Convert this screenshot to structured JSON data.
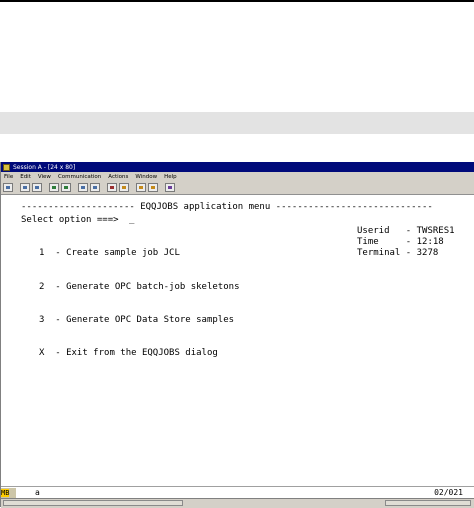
{
  "window": {
    "title": "Session A - [24 x 80]"
  },
  "menubar": {
    "items": [
      "File",
      "Edit",
      "View",
      "Communication",
      "Actions",
      "Window",
      "Help"
    ]
  },
  "toolbar": {
    "icons": [
      "print-icon",
      "copy-icon",
      "paste-icon",
      "send-icon",
      "receive-icon",
      "display-icon",
      "keypad-icon",
      "color-icon",
      "map-icon",
      "record-icon",
      "play-icon",
      "help-icon"
    ]
  },
  "screen": {
    "header": "--------------------- EQQJOBS application menu -----------------------------",
    "prompt": "Select option ===>",
    "cursor": "_",
    "info_labels": {
      "userid": "Userid   - TWSRES1",
      "time": "Time     - 12:18",
      "terminal": "Terminal - 3278"
    },
    "options": [
      "1  - Create sample job JCL",
      "2  - Generate OPC batch-job skeletons",
      "3  - Generate OPC Data Store samples",
      "X  - Exit from the EQQJOBS dialog"
    ]
  },
  "oia": {
    "indicator": "MB",
    "input_mode": "a",
    "cursor_position": "02/021"
  },
  "colors": {
    "titlebar": "#000a7a",
    "chrome": "#d4d0c8",
    "band": "#e3e3e3"
  }
}
